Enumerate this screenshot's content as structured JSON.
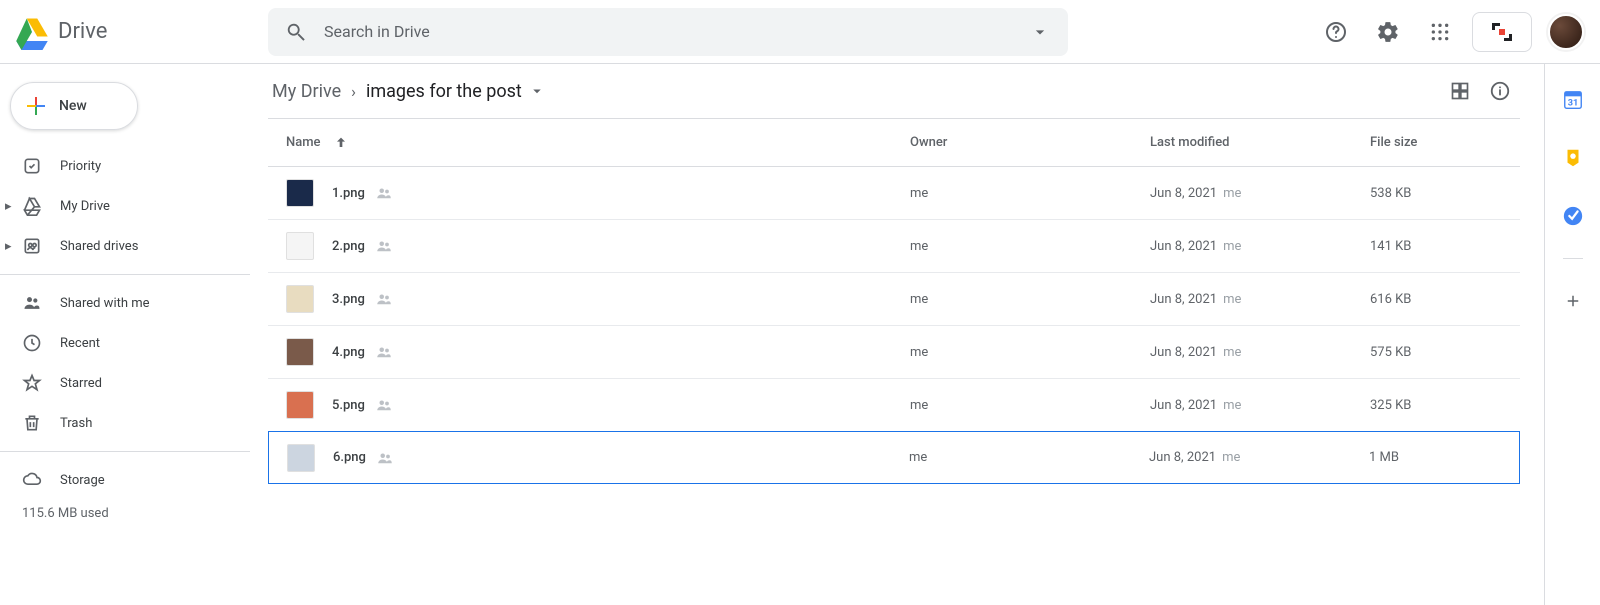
{
  "header": {
    "app_name": "Drive",
    "search_placeholder": "Search in Drive"
  },
  "sidebar": {
    "new_label": "New",
    "items": [
      {
        "label": "Priority"
      },
      {
        "label": "My Drive"
      },
      {
        "label": "Shared drives"
      },
      {
        "label": "Shared with me"
      },
      {
        "label": "Recent"
      },
      {
        "label": "Starred"
      },
      {
        "label": "Trash"
      },
      {
        "label": "Storage"
      }
    ],
    "storage_used": "115.6 MB used"
  },
  "breadcrumb": {
    "root": "My Drive",
    "chev": "›",
    "current": "images for the post"
  },
  "columns": {
    "name": "Name",
    "owner": "Owner",
    "modified": "Last modified",
    "size": "File size"
  },
  "files": [
    {
      "name": "1.png",
      "owner": "me",
      "modified_date": "Jun 8, 2021",
      "modified_by": "me",
      "size": "538 KB",
      "thumb": "#1a2a4a"
    },
    {
      "name": "2.png",
      "owner": "me",
      "modified_date": "Jun 8, 2021",
      "modified_by": "me",
      "size": "141 KB",
      "thumb": "#f5f5f5"
    },
    {
      "name": "3.png",
      "owner": "me",
      "modified_date": "Jun 8, 2021",
      "modified_by": "me",
      "size": "616 KB",
      "thumb": "#e8dcc0"
    },
    {
      "name": "4.png",
      "owner": "me",
      "modified_date": "Jun 8, 2021",
      "modified_by": "me",
      "size": "575 KB",
      "thumb": "#7a5a4a"
    },
    {
      "name": "5.png",
      "owner": "me",
      "modified_date": "Jun 8, 2021",
      "modified_by": "me",
      "size": "325 KB",
      "thumb": "#d97050"
    },
    {
      "name": "6.png",
      "owner": "me",
      "modified_date": "Jun 8, 2021",
      "modified_by": "me",
      "size": "1 MB",
      "thumb": "#ccd5e0"
    }
  ],
  "selected_index": 5
}
